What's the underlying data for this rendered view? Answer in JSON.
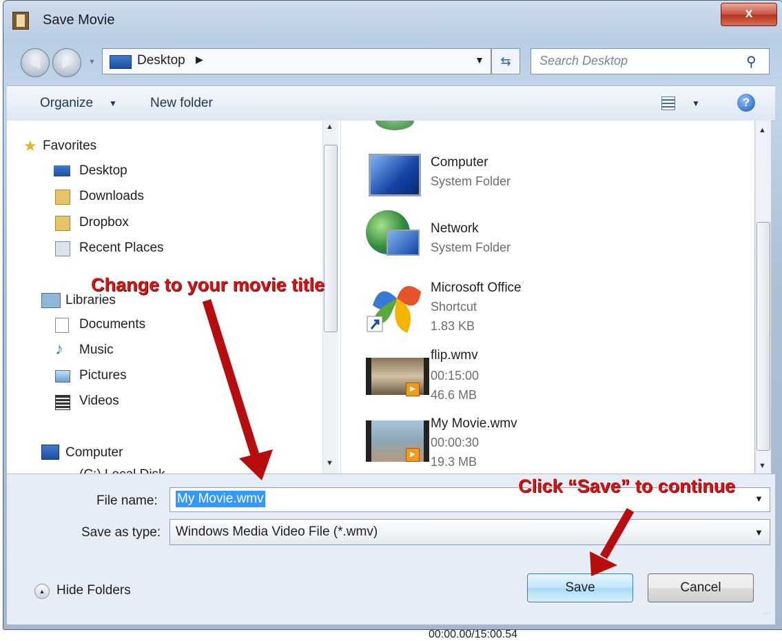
{
  "window": {
    "title": "Save Movie",
    "close_label": "x"
  },
  "nav": {
    "address": "Desktop",
    "search_placeholder": "Search Desktop"
  },
  "toolbar": {
    "organize": "Organize",
    "new_folder": "New folder"
  },
  "navpane": {
    "favorites_header": "Favorites",
    "favorites": [
      "Desktop",
      "Downloads",
      "Dropbox",
      "Recent Places"
    ],
    "libraries_header": "Libraries",
    "libraries": [
      "Documents",
      "Music",
      "Pictures",
      "Videos"
    ],
    "computer_header": "Computer",
    "computer_items": [
      "(C:) Local Disk"
    ]
  },
  "files": [
    {
      "name": "Computer",
      "line2": "System Folder",
      "line3": ""
    },
    {
      "name": "Network",
      "line2": "System Folder",
      "line3": ""
    },
    {
      "name": "Microsoft Office",
      "line2": "Shortcut",
      "line3": "1.83 KB"
    },
    {
      "name": "flip.wmv",
      "line2": "00:15:00",
      "line3": "46.6 MB"
    },
    {
      "name": "My Movie.wmv",
      "line2": "00:00:30",
      "line3": "19.3 MB"
    }
  ],
  "form": {
    "file_name_label": "File name:",
    "file_name_value": "My Movie.wmv",
    "save_as_type_label": "Save as type:",
    "save_as_type_value": "Windows Media Video File (*.wmv)"
  },
  "buttons": {
    "hide_folders": "Hide Folders",
    "save": "Save",
    "cancel": "Cancel"
  },
  "background_status": "00:00.00/15:00.54",
  "annotations": {
    "title_hint": "Change to your movie title",
    "save_hint": "Click “Save” to continue",
    "color": "#d31515"
  }
}
